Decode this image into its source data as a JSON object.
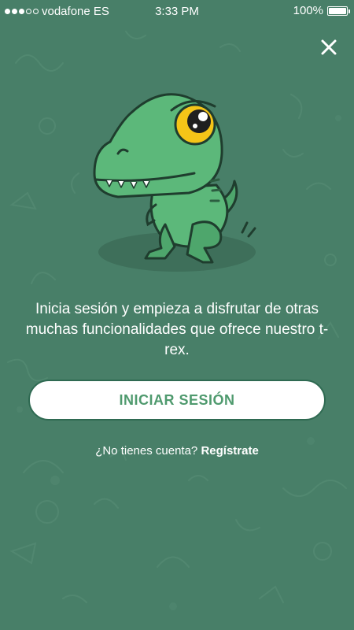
{
  "status_bar": {
    "carrier": "vodafone ES",
    "time": "3:33 PM",
    "battery_percent": "100%",
    "battery_level": 1.0,
    "signal_bars_filled": 3,
    "signal_bars_total": 5
  },
  "colors": {
    "background": "#487f68",
    "button_background": "#ffffff",
    "button_text": "#4f9a6e",
    "text": "#ffffff"
  },
  "mascot": {
    "icon": "t-rex-mascot"
  },
  "close": {
    "icon": "close-icon"
  },
  "message": "Inicia sesión y empieza a disfrutar de otras muchas funcionalidades que ofrece nuestro t-rex.",
  "login_button": {
    "label": "INICIAR SESIÓN"
  },
  "register": {
    "prompt": "¿No tienes cuenta?",
    "link": "Regístrate"
  }
}
